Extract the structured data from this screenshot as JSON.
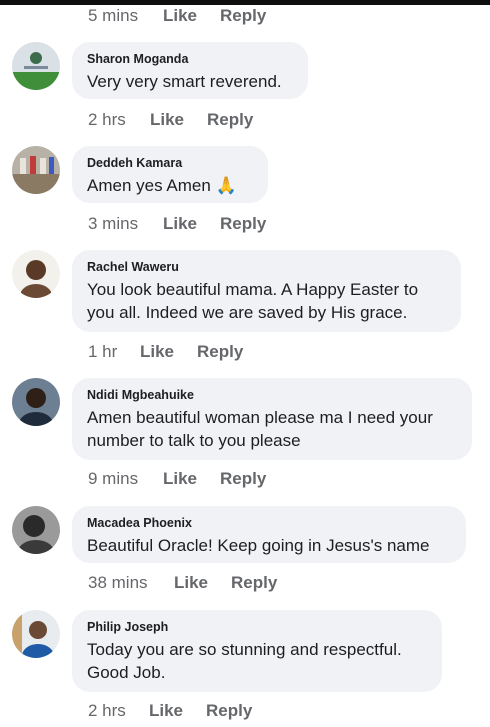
{
  "top_meta": {
    "time": "5 mins",
    "like": "Like",
    "reply": "Reply"
  },
  "comments": [
    {
      "author": "Sharon Moganda",
      "text": "Very very smart reverend.",
      "time": "2 hrs",
      "like": "Like",
      "reply": "Reply"
    },
    {
      "author": "Deddeh Kamara",
      "text": "Amen yes Amen",
      "emoji": "🙏",
      "time": "3 mins",
      "like": "Like",
      "reply": "Reply"
    },
    {
      "author": "Rachel Waweru",
      "text": "You look beautiful mama. A Happy Easter to you all. Indeed we are saved by His grace.",
      "time": "1 hr",
      "like": "Like",
      "reply": "Reply"
    },
    {
      "author": "Ndidi Mgbeahuike",
      "text": "Amen beautiful woman please ma I need your number to talk to you please",
      "time": "9 mins",
      "like": "Like",
      "reply": "Reply"
    },
    {
      "author": "Macadea Phoenix",
      "text": "Beautiful Oracle! Keep going in Jesus's name",
      "time": "38 mins",
      "like": "Like",
      "reply": "Reply"
    },
    {
      "author": "Philip Joseph",
      "text": "Today you are so stunning and respectful. Good Job.",
      "time": "2 hrs",
      "like": "Like",
      "reply": "Reply"
    }
  ],
  "colors": {
    "bubble": "#f0f2f5",
    "meta": "#65676b",
    "text": "#1c1e21"
  }
}
